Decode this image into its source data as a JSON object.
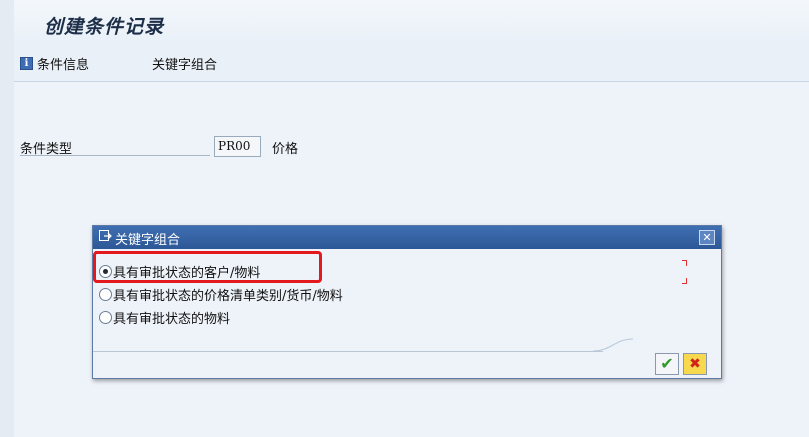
{
  "page": {
    "title": "创建条件记录"
  },
  "toolbar": {
    "condition_info_label": "条件信息",
    "key_combination_label": "关键字组合",
    "info_icon": "info-icon"
  },
  "form": {
    "condition_type_label": "条件类型",
    "condition_type_value": "PR00",
    "condition_type_desc": "价格"
  },
  "dialog": {
    "title": "关键字组合",
    "header_icon": "dialog-window-icon",
    "close_label": "✕",
    "options": [
      {
        "label": "具有审批状态的客户/物料",
        "selected": true
      },
      {
        "label": "具有审批状态的价格清单类别/货币/物料",
        "selected": false
      },
      {
        "label": "具有审批状态的物料",
        "selected": false
      }
    ],
    "confirm_label": "✔",
    "cancel_label": "✖"
  },
  "colors": {
    "header_blue": "#3f6fb2",
    "highlight_red": "#e3191e",
    "confirm_green": "#2e9a2a",
    "cancel_yellow": "#f6d94e"
  }
}
